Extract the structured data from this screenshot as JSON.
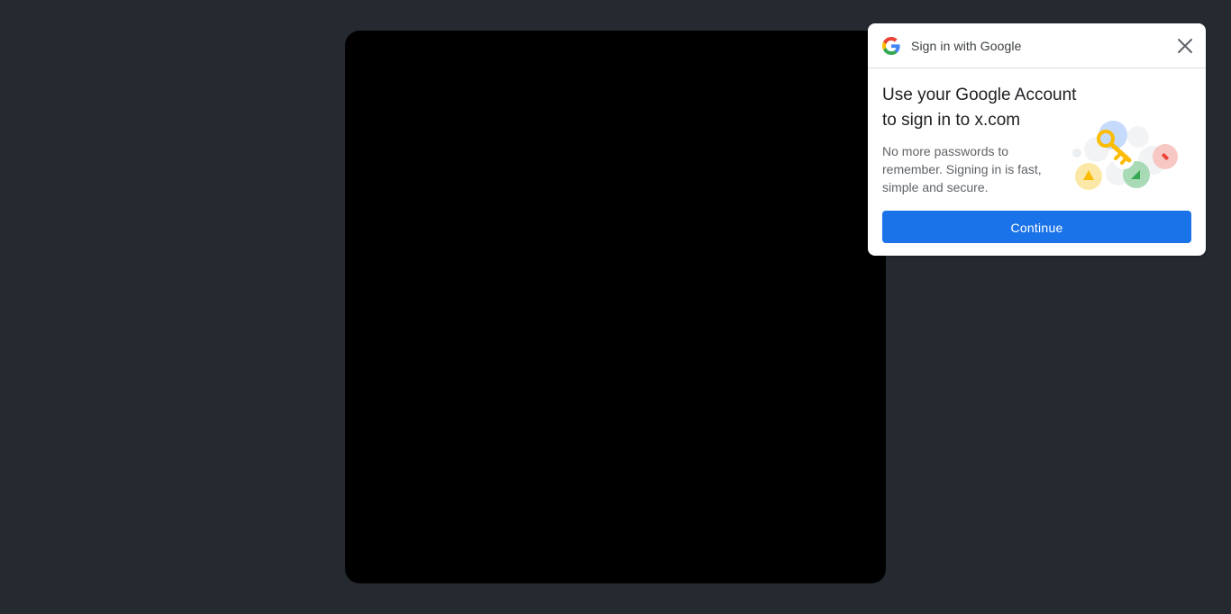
{
  "gsi": {
    "header_title": "Sign in with Google",
    "title_line1": "Use your Google Account",
    "title_line2": "to sign in to x.com",
    "desc_line1": "No more passwords to",
    "desc_line2": "remember. Signing in is fast,",
    "desc_line3": "simple and secure.",
    "continue_label": "Continue",
    "close_icon": "close-icon",
    "logo_icon": "google-g-icon",
    "illustration": "key-illustration"
  },
  "colors": {
    "background": "#252a31",
    "modal": "#000000",
    "button": "#1a73e8"
  }
}
